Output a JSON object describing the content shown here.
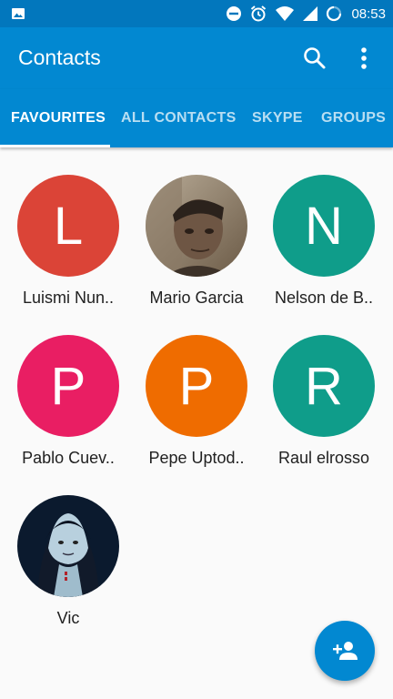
{
  "status_bar": {
    "time": "08:53",
    "icons": [
      "image-icon",
      "do-not-disturb-icon",
      "alarm-icon",
      "wifi-icon",
      "signal-icon",
      "battery-charging-icon"
    ]
  },
  "app_bar": {
    "title": "Contacts",
    "search_icon": "search-icon",
    "more_icon": "more-vert-icon"
  },
  "tabs": [
    {
      "label": "FAVOURITES",
      "active": true
    },
    {
      "label": "ALL CONTACTS",
      "active": false
    },
    {
      "label": "SKYPE",
      "active": false
    },
    {
      "label": "GROUPS",
      "active": false
    }
  ],
  "contacts": [
    {
      "name": "Luismi Nun..",
      "initial": "L",
      "color": "#DB4437",
      "photo": false
    },
    {
      "name": "Mario Garcia",
      "initial": "",
      "color": "#6D5C4A",
      "photo": true
    },
    {
      "name": "Nelson de B..",
      "initial": "N",
      "color": "#0F9D8A",
      "photo": false
    },
    {
      "name": "Pablo Cuev..",
      "initial": "P",
      "color": "#E91E63",
      "photo": false
    },
    {
      "name": "Pepe Uptod..",
      "initial": "P",
      "color": "#EF6C00",
      "photo": false
    },
    {
      "name": "Raul elrosso",
      "initial": "R",
      "color": "#0F9D8A",
      "photo": false
    },
    {
      "name": "Vic",
      "initial": "",
      "color": "#0B1A2E",
      "photo": true
    }
  ],
  "fab": {
    "icon": "add-person-icon"
  }
}
